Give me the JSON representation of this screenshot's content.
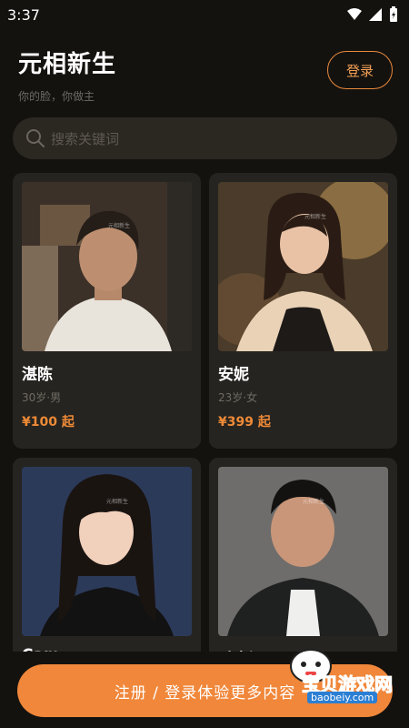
{
  "status_bar": {
    "time": "3:37"
  },
  "header": {
    "title": "元相新生",
    "subtitle": "你的脸，你做主",
    "login_label": "登录"
  },
  "search": {
    "placeholder": "搜索关键词"
  },
  "cards": [
    {
      "name": "湛陈",
      "meta": "30岁·男",
      "price": "¥100 起",
      "photo_watermark": "元相新生"
    },
    {
      "name": "安妮",
      "meta": "23岁·女",
      "price": "¥399 起",
      "photo_watermark": "元相新生"
    },
    {
      "name": "Cam",
      "photo_watermark": "元相新生"
    },
    {
      "name": "毛春深",
      "photo_watermark": "元相新生"
    }
  ],
  "cta": {
    "label": "注册 / 登录体验更多内容"
  },
  "overlay_watermark": {
    "text": "宝贝游戏网",
    "url": "baobeiy.com"
  },
  "colors": {
    "accent": "#f0873a",
    "background": "#14120f",
    "card": "#262420"
  }
}
